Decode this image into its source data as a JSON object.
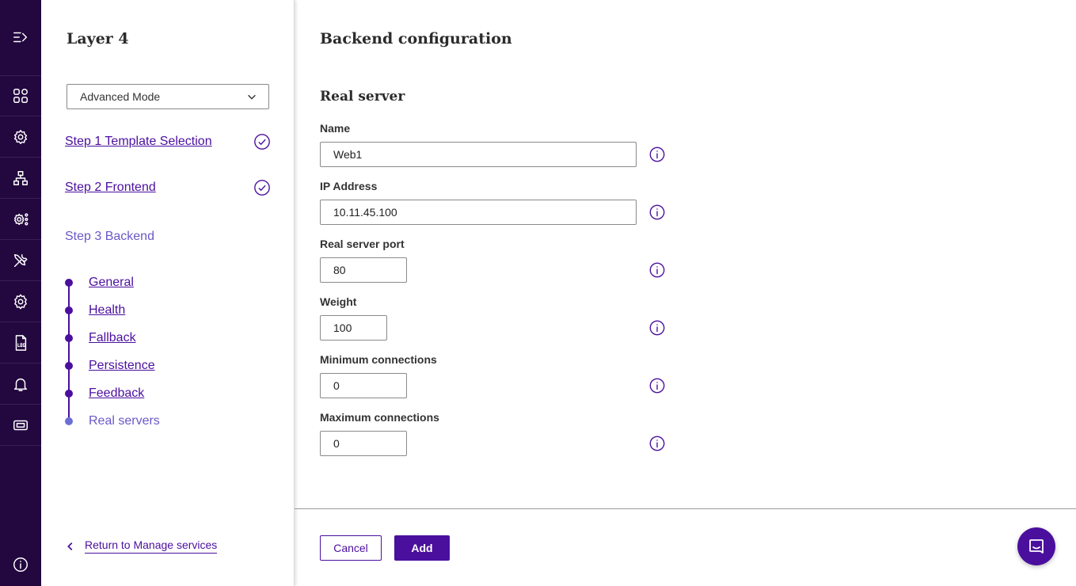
{
  "rail": {
    "items": [
      {
        "icon": "menu-expand-icon"
      },
      {
        "icon": "dashboard-icon"
      },
      {
        "icon": "services-icon"
      },
      {
        "icon": "network-icon"
      },
      {
        "icon": "settings-cluster-icon"
      },
      {
        "icon": "tools-icon"
      },
      {
        "icon": "gear-icon"
      },
      {
        "icon": "log-file-icon"
      },
      {
        "icon": "bell-icon"
      },
      {
        "icon": "ticket-icon"
      }
    ],
    "bottom_icon": "info-icon"
  },
  "panel": {
    "title": "Layer 4",
    "mode_select": {
      "value": "Advanced Mode"
    },
    "steps": [
      {
        "label": "Step 1 Template Selection",
        "done": true
      },
      {
        "label": "Step 2 Frontend",
        "done": true
      },
      {
        "label": "Step 3 Backend",
        "done": false
      }
    ],
    "sub_steps": [
      {
        "label": "General"
      },
      {
        "label": "Health"
      },
      {
        "label": "Fallback"
      },
      {
        "label": "Persistence"
      },
      {
        "label": "Feedback"
      },
      {
        "label": "Real servers"
      }
    ],
    "return_label": "Return to Manage services"
  },
  "main": {
    "title": "Backend configuration",
    "section_title": "Real server",
    "fields": [
      {
        "label": "Name",
        "value": "Web1"
      },
      {
        "label": "IP Address",
        "value": "10.11.45.100"
      },
      {
        "label": "Real server port",
        "value": "80"
      },
      {
        "label": "Weight",
        "value": "100"
      },
      {
        "label": "Minimum connections",
        "value": "0"
      },
      {
        "label": "Maximum connections",
        "value": "0"
      }
    ],
    "cancel_label": "Cancel",
    "add_label": "Add"
  },
  "colors": {
    "rail_bg": "#23073f",
    "accent": "#4b0f9e",
    "current_step": "#6b58c8"
  }
}
